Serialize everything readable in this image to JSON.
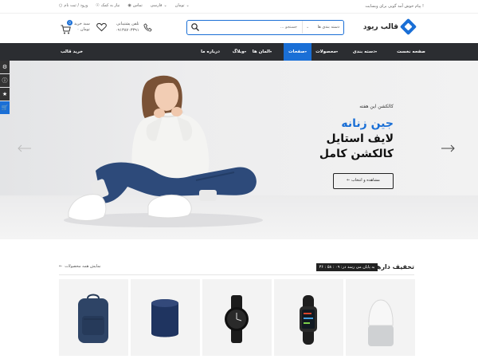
{
  "topbar": {
    "welcome": "پیام خوش آمد گویی برای وبسایت !",
    "currency": "تومان",
    "language": "فارسی",
    "contact": "تماس",
    "help": "نیاز به کمک",
    "login": "ورود / ثبت نام"
  },
  "header": {
    "logo_text": "قالب ریود",
    "search": {
      "category": "دسته بندی ها",
      "placeholder": "جستجو ..."
    },
    "phone": {
      "label": "تلفن پشتیبانی",
      "number": "۰۹۱۳۸۷۰۳۳۹۱"
    },
    "cart": {
      "label": "سبد خرید",
      "amount": "۰ تومان",
      "count": "0"
    }
  },
  "nav": {
    "items": [
      {
        "label": "صفحه نخست"
      },
      {
        "label": "دسته بندی"
      },
      {
        "label": "محصولات"
      },
      {
        "label": "صفحات"
      },
      {
        "label": "المان ها"
      },
      {
        "label": "وبلاگ"
      },
      {
        "label": "درباره ما"
      }
    ],
    "buy_theme": "خرید قالب"
  },
  "hero": {
    "kicker": "کالکشن این هفته",
    "line1": "جین زنانه",
    "line2": "لایف استایل",
    "line3": "کالکشن کامل",
    "button": "مشاهده و انتخاب"
  },
  "deals": {
    "title": "تخفیف دارها",
    "timer": "به پایان می رسد در: ۰۹ : ۵۸ : ۳۶",
    "see_all": "نمایش همه محصولات"
  },
  "colors": {
    "accent": "#1a6fd6",
    "nav_bg": "#2b2d31"
  }
}
